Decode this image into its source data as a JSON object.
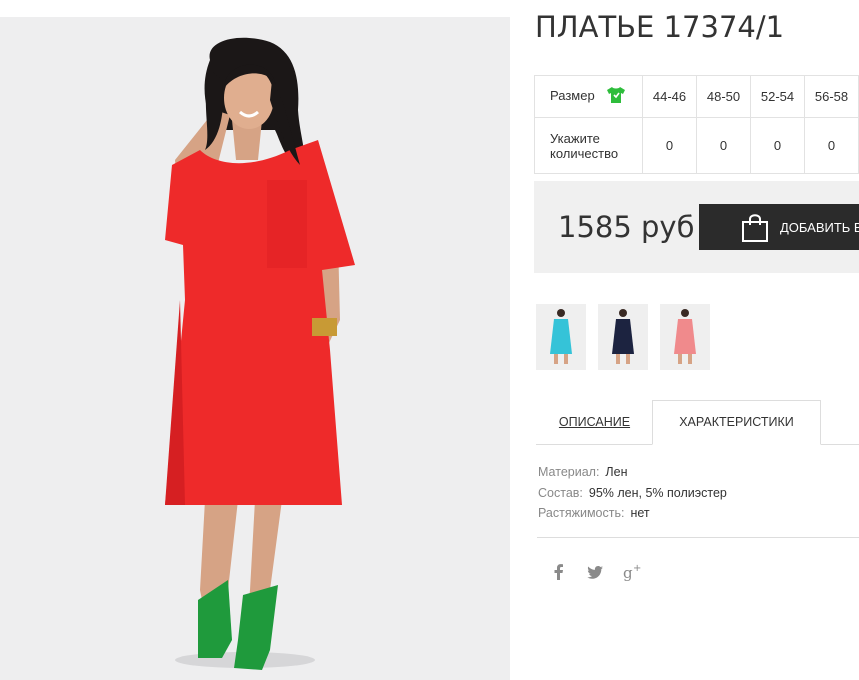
{
  "product": {
    "title": "ПЛАТЬЕ 17374/1"
  },
  "sizes": {
    "size_label": "Размер",
    "qty_label_1": "Укажите",
    "qty_label_2": "количество",
    "columns": [
      "44-46",
      "48-50",
      "52-54",
      "56-58"
    ],
    "quantities": [
      "0",
      "0",
      "0",
      "0"
    ]
  },
  "price": {
    "amount": "1585 руб",
    "cart_button": "ДОБАВИТЬ В"
  },
  "thumbnails": [
    {
      "name": "thumbnail-turquoise",
      "color": "#35c3d8"
    },
    {
      "name": "thumbnail-navy",
      "color": "#1c2340"
    },
    {
      "name": "thumbnail-coral",
      "color": "#f08a8c"
    }
  ],
  "tabs": {
    "description": "ОПИСАНИЕ",
    "characteristics": "ХАРАКТЕРИСТИКИ"
  },
  "characteristics": [
    {
      "key": "Материал:",
      "value": "Лен"
    },
    {
      "key": "Состав:",
      "value": "95% лен, 5% полиэстер"
    },
    {
      "key": "Растяжимость:",
      "value": "нет"
    }
  ],
  "social": [
    "facebook-icon",
    "twitter-icon",
    "google-plus-icon"
  ],
  "colors": {
    "dress": "#ee2a2a",
    "shoes": "#1f9a3c",
    "size_icon": "#2ebd3c",
    "button": "#2b2b2b"
  }
}
